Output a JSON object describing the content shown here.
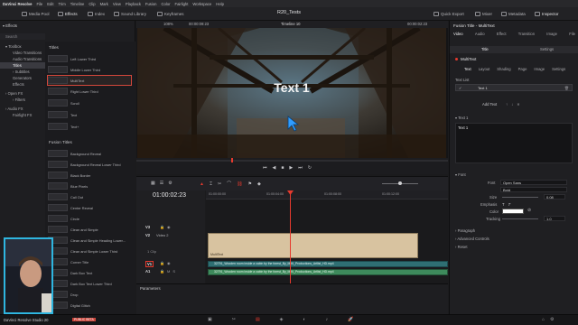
{
  "menubar": {
    "items": [
      "DaVinci Resolve",
      "File",
      "Edit",
      "Trim",
      "Timeline",
      "Clip",
      "Mark",
      "View",
      "Playback",
      "Fusion",
      "Color",
      "Fairlight",
      "Workspace",
      "Help"
    ]
  },
  "toolbar": {
    "left": [
      "Media Pool",
      "Effects",
      "Index",
      "Sound Library",
      "Keyframes"
    ],
    "right": [
      "Quick Export",
      "Mixer",
      "Metadata",
      "Inspector"
    ],
    "project_title": "R20_Tests"
  },
  "tree": {
    "toolbox": "Toolbox",
    "items": [
      "Video Transitions",
      "Audio Transitions",
      "Titles",
      "Subtitles",
      "Generators",
      "Effects",
      "Open FX",
      "Filters",
      "Audio FX",
      "Fairlight FX"
    ],
    "search": "Search"
  },
  "library": {
    "titles_header": "Titles",
    "titles": [
      "Left Lower Third",
      "Middle Lower Third",
      "MultiText",
      "Right Lower Third",
      "Scroll",
      "Text",
      "Text+"
    ],
    "fusion_header": "Fusion Titles",
    "fusion": [
      "Background Reveal",
      "Background Reveal Lower Third",
      "Black Border",
      "Blue Pixels",
      "Call Out",
      "Center Reveal",
      "Circle",
      "Clean and Simple",
      "Clean and Simple Heading Lower...",
      "Clean and Simple Lower Third",
      "Corner Title",
      "Dark Box Text",
      "Dark Box Text Lower Third",
      "Drop",
      "Digital Glitch"
    ]
  },
  "viewer": {
    "zoom": "108%",
    "timecode_in": "00:00:09:23",
    "timeline_name": "Timeline 10",
    "timecode_cur": "00:00:02:23",
    "overlay_text": "Text 1"
  },
  "timeline": {
    "timecode": "01:00:02:23",
    "ruler": [
      "01:00:00:00",
      "01:00:04:00",
      "01:00:08:00",
      "01:00:12:00"
    ],
    "tracks": [
      {
        "id": "V3",
        "name": ""
      },
      {
        "id": "V2",
        "name": "Video 2"
      },
      {
        "id": "",
        "name": "1 Clip"
      },
      {
        "id": "V1",
        "name": ""
      },
      {
        "id": "A1",
        "name": ""
      }
    ],
    "clips": {
      "title": "MultiText",
      "video": "32791_Wooden room inside a cabin by the forest_By_MiKi_Productions_Artlist_HD.mp4",
      "audio": "32791_Wooden room inside a cabin by the forest_By_MiKi_Productions_Artlist_HD.mp4"
    },
    "params_label": "Parameters"
  },
  "inspector": {
    "title": "Fusion Title - MultiText",
    "tabs": [
      "Video",
      "Audio",
      "Effect",
      "Transition",
      "Image",
      "File"
    ],
    "subtabs": [
      "Title",
      "Settings"
    ],
    "tool_name": "MultiText",
    "tool_tabs": [
      "Text",
      "Layout",
      "Shading",
      "Page",
      "Image",
      "Settings"
    ],
    "text_list_label": "Text List",
    "text_items": [
      "Text 1"
    ],
    "add_text": "Add Text",
    "section_text": "Text 1",
    "text_value": "Text 1",
    "font_section": "Font",
    "font_label": "Font",
    "font_value": "Open Sans",
    "style_value": "Bold",
    "size_label": "Size",
    "size_value": "0.08",
    "emphasis_label": "Emphasis",
    "tracking_label": "Tracking",
    "tracking_value": "1.0",
    "color_label": "Color",
    "color_hex": "#ffffff",
    "sections": [
      "Paragraph",
      "Advanced Controls",
      "Reset"
    ]
  },
  "status": {
    "app": "DaVinci Resolve Studio 20",
    "badge": "PUBLIC BETA"
  },
  "colors": {
    "accent_red": "#e63a2e",
    "clip_tan": "#d8c3a0",
    "clip_teal": "#2f6f73",
    "audio_green": "#3e8a5c"
  }
}
